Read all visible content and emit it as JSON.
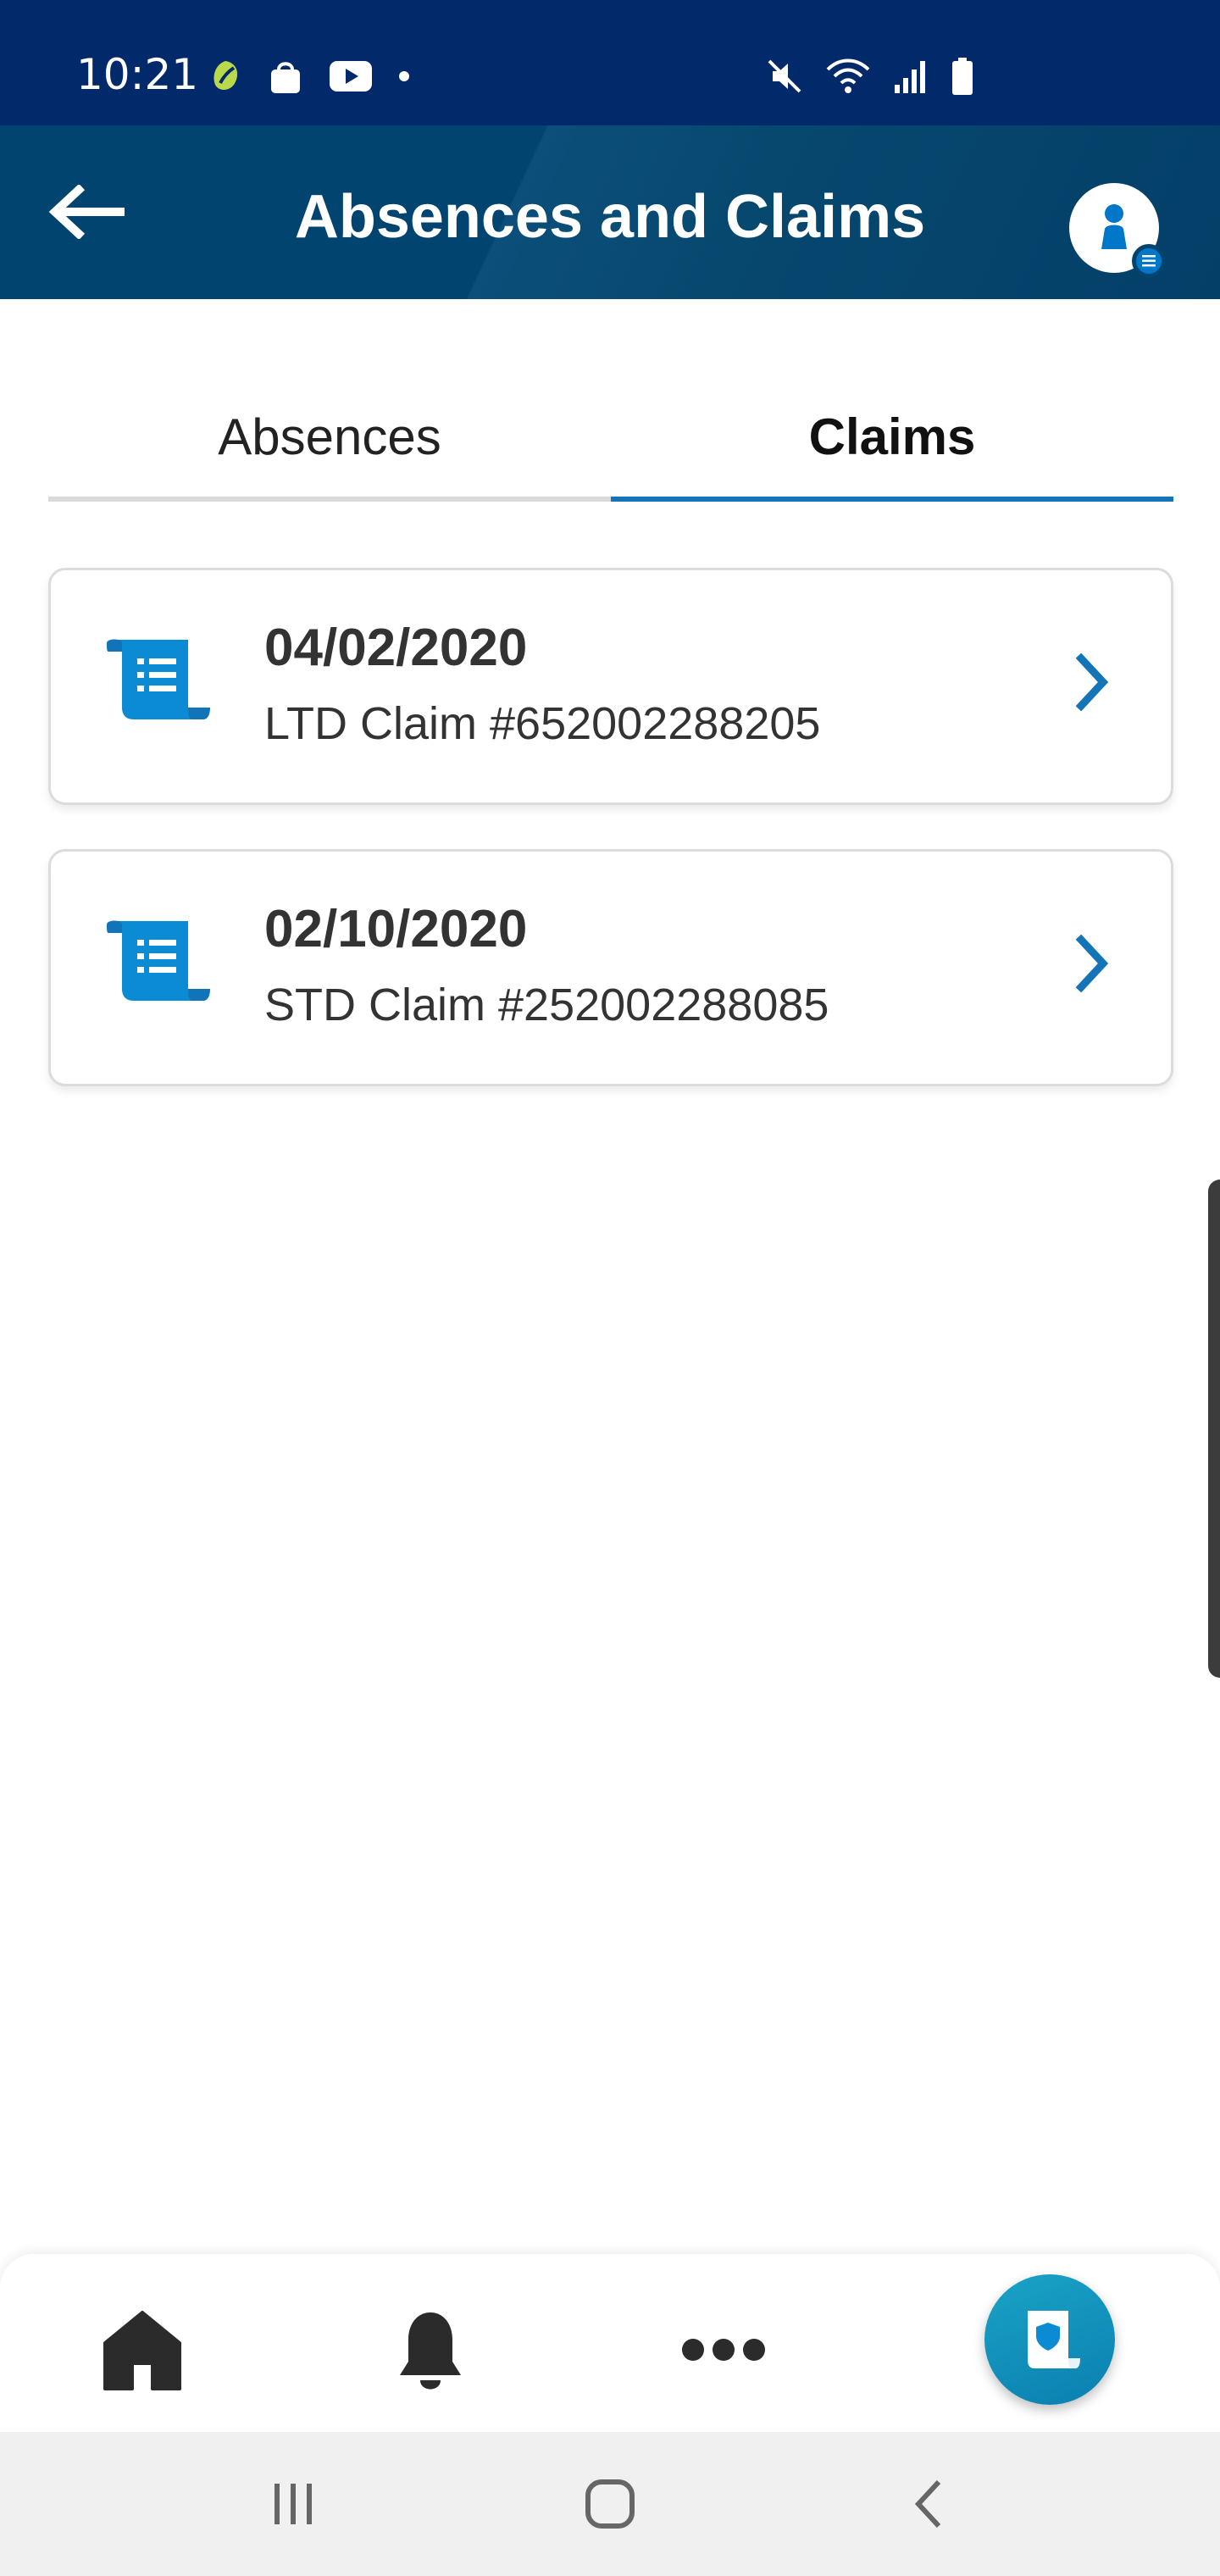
{
  "status_bar": {
    "time": "10:21",
    "left_icons": [
      "leaf-icon",
      "shopping-bag-icon",
      "youtube-icon",
      "dot-icon"
    ],
    "right_icons": [
      "mute-icon",
      "wifi-icon",
      "signal-icon",
      "battery-icon"
    ]
  },
  "header": {
    "title": "Absences and Claims",
    "back_icon": "arrow-left-icon",
    "profile_icon": "user-icon"
  },
  "tabs": [
    {
      "label": "Absences",
      "active": false
    },
    {
      "label": "Claims",
      "active": true
    }
  ],
  "claims": [
    {
      "date": "04/02/2020",
      "title": "LTD Claim #652002288205",
      "icon": "scroll-document-icon"
    },
    {
      "date": "02/10/2020",
      "title": "STD Claim #252002288085",
      "icon": "scroll-document-icon"
    }
  ],
  "bottom_nav": {
    "items": [
      "home-icon",
      "bell-icon",
      "more-icon",
      "claims-icon"
    ],
    "active": "claims-icon"
  },
  "system_nav": [
    "recent-apps-icon",
    "home-circle-icon",
    "back-chevron-icon"
  ],
  "colors": {
    "status_bar": "#022a6b",
    "header": "#00446f",
    "accent": "#1474b8",
    "fab": "#0a8fbf",
    "text": "#333333"
  }
}
